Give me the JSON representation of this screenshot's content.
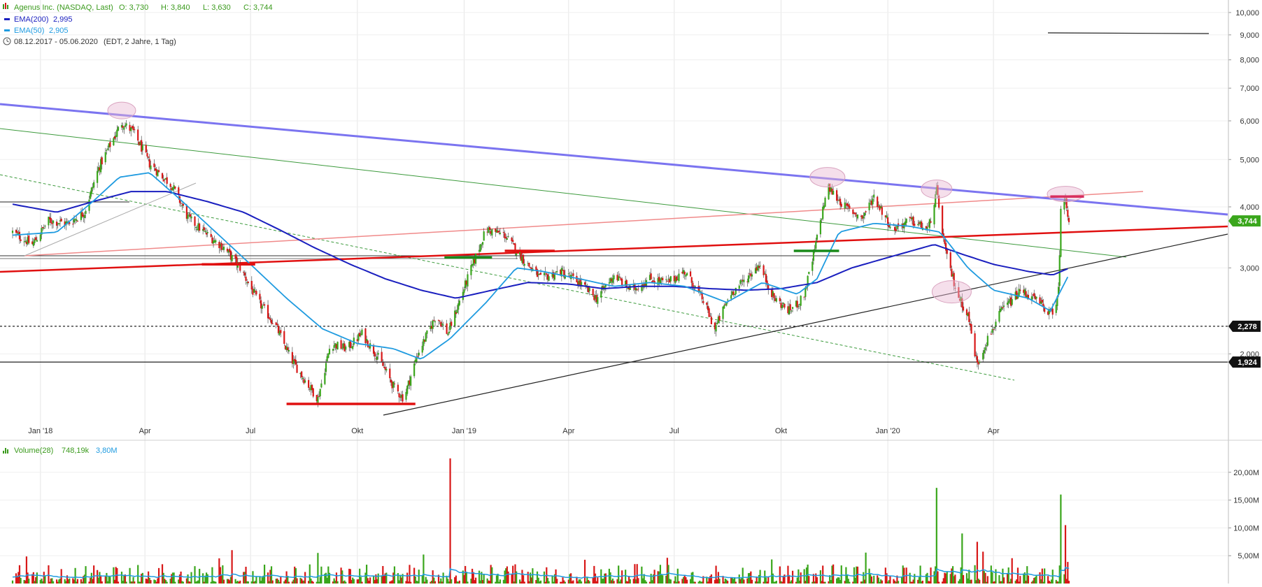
{
  "header": {
    "title": "Agenus Inc. (NASDAQ, Last)",
    "ohlc": {
      "open": "O: 3,730",
      "high": "H: 3,840",
      "low": "L: 3,630",
      "close": "C: 3,744"
    },
    "ema200_label": "EMA(200)",
    "ema200_value": "2,995",
    "ema50_label": "EMA(50)",
    "ema50_value": "2,905",
    "range_text": "08.12.2017 - 05.06.2020",
    "range_note": "(EDT, 2 Jahre, 1 Tag)"
  },
  "colors": {
    "title_green": "#3a9a1c",
    "ema200": "#1a1fbf",
    "ema50": "#1f9be0",
    "bull": "#3aa61c",
    "bear": "#d81818",
    "trend_blue": "#7b74f0",
    "support_red": "#e01010",
    "light_red": "#f08a8a",
    "green_line": "#3c9a3c",
    "circle": "#e8b7d2"
  },
  "chart_data": [
    {
      "type": "candlestick",
      "title": "Agenus Inc. (NASDAQ, Last)",
      "scale": "log",
      "ylim": [
        1.45,
        10.4
      ],
      "y_ticks": [
        "2,000",
        "3,000",
        "4,000",
        "5,000",
        "6,000",
        "7,000",
        "8,000",
        "9,000",
        "10,000"
      ],
      "y_tick_values": [
        2,
        3,
        4,
        5,
        6,
        7,
        8,
        9,
        10
      ],
      "x_range": [
        "2017-12-08",
        "2020-06-05"
      ],
      "x_ticks": [
        "Jan '18",
        "Apr",
        "Jul",
        "Okt",
        "Jan '19",
        "Apr",
        "Jul",
        "Okt",
        "Jan '20",
        "Apr"
      ],
      "x_tick_dates": [
        "2018-01-01",
        "2018-04-01",
        "2018-07-01",
        "2018-10-01",
        "2019-01-01",
        "2019-04-01",
        "2019-07-01",
        "2019-10-01",
        "2020-01-01",
        "2020-04-01"
      ],
      "price_path": [
        [
          "2017-12-08",
          3.55
        ],
        [
          "2017-12-25",
          3.35
        ],
        [
          "2018-01-08",
          3.75
        ],
        [
          "2018-01-25",
          3.7
        ],
        [
          "2018-02-08",
          3.9
        ],
        [
          "2018-02-20",
          4.8
        ],
        [
          "2018-03-01",
          5.3
        ],
        [
          "2018-03-12",
          5.95
        ],
        [
          "2018-03-22",
          5.7
        ],
        [
          "2018-04-05",
          4.9
        ],
        [
          "2018-04-25",
          4.4
        ],
        [
          "2018-05-08",
          3.8
        ],
        [
          "2018-05-22",
          3.55
        ],
        [
          "2018-06-08",
          3.3
        ],
        [
          "2018-06-22",
          3.0
        ],
        [
          "2018-07-08",
          2.55
        ],
        [
          "2018-07-22",
          2.3
        ],
        [
          "2018-08-05",
          1.95
        ],
        [
          "2018-08-18",
          1.75
        ],
        [
          "2018-08-28",
          1.62
        ],
        [
          "2018-09-08",
          2.1
        ],
        [
          "2018-09-22",
          2.05
        ],
        [
          "2018-10-05",
          2.2
        ],
        [
          "2018-10-20",
          1.95
        ],
        [
          "2018-11-02",
          1.7
        ],
        [
          "2018-11-10",
          1.62
        ],
        [
          "2018-11-22",
          2.0
        ],
        [
          "2018-12-08",
          2.4
        ],
        [
          "2018-12-18",
          2.2
        ],
        [
          "2019-01-05",
          2.9
        ],
        [
          "2019-01-20",
          3.6
        ],
        [
          "2019-02-05",
          3.5
        ],
        [
          "2019-02-22",
          3.1
        ],
        [
          "2019-03-08",
          2.85
        ],
        [
          "2019-03-25",
          2.95
        ],
        [
          "2019-04-10",
          2.8
        ],
        [
          "2019-04-25",
          2.6
        ],
        [
          "2019-05-10",
          2.9
        ],
        [
          "2019-05-25",
          2.7
        ],
        [
          "2019-06-10",
          2.85
        ],
        [
          "2019-06-25",
          2.8
        ],
        [
          "2019-07-10",
          2.95
        ],
        [
          "2019-07-25",
          2.6
        ],
        [
          "2019-08-05",
          2.25
        ],
        [
          "2019-08-18",
          2.65
        ],
        [
          "2019-09-01",
          2.85
        ],
        [
          "2019-09-12",
          3.05
        ],
        [
          "2019-09-25",
          2.6
        ],
        [
          "2019-10-08",
          2.45
        ],
        [
          "2019-10-20",
          2.6
        ],
        [
          "2019-10-28",
          3.1
        ],
        [
          "2019-11-05",
          3.85
        ],
        [
          "2019-11-10",
          4.4
        ],
        [
          "2019-11-25",
          4.0
        ],
        [
          "2019-12-10",
          3.8
        ],
        [
          "2019-12-20",
          4.2
        ],
        [
          "2020-01-05",
          3.6
        ],
        [
          "2020-01-20",
          3.75
        ],
        [
          "2020-02-05",
          3.6
        ],
        [
          "2020-02-12",
          4.3
        ],
        [
          "2020-02-20",
          3.2
        ],
        [
          "2020-03-01",
          2.65
        ],
        [
          "2020-03-10",
          2.4
        ],
        [
          "2020-03-18",
          1.9
        ],
        [
          "2020-03-25",
          2.1
        ],
        [
          "2020-04-08",
          2.45
        ],
        [
          "2020-04-25",
          2.7
        ],
        [
          "2020-05-10",
          2.55
        ],
        [
          "2020-05-22",
          2.4
        ],
        [
          "2020-05-27",
          2.7
        ],
        [
          "2020-05-29",
          3.9
        ],
        [
          "2020-06-02",
          4.2
        ],
        [
          "2020-06-05",
          3.744
        ]
      ],
      "series": [
        {
          "name": "EMA(200)",
          "points": [
            [
              "2017-12-08",
              4.05
            ],
            [
              "2018-01-15",
              3.9
            ],
            [
              "2018-02-15",
              4.1
            ],
            [
              "2018-03-20",
              4.3
            ],
            [
              "2018-04-20",
              4.3
            ],
            [
              "2018-05-25",
              4.1
            ],
            [
              "2018-06-25",
              3.9
            ],
            [
              "2018-07-25",
              3.6
            ],
            [
              "2018-08-25",
              3.3
            ],
            [
              "2018-09-25",
              3.05
            ],
            [
              "2018-10-25",
              2.85
            ],
            [
              "2018-11-25",
              2.7
            ],
            [
              "2018-12-25",
              2.6
            ],
            [
              "2019-01-25",
              2.7
            ],
            [
              "2019-02-25",
              2.8
            ],
            [
              "2019-04-01",
              2.78
            ],
            [
              "2019-05-01",
              2.72
            ],
            [
              "2019-06-01",
              2.75
            ],
            [
              "2019-07-01",
              2.75
            ],
            [
              "2019-08-01",
              2.72
            ],
            [
              "2019-09-01",
              2.7
            ],
            [
              "2019-10-01",
              2.72
            ],
            [
              "2019-11-01",
              2.8
            ],
            [
              "2019-12-01",
              3.0
            ],
            [
              "2020-01-01",
              3.15
            ],
            [
              "2020-02-10",
              3.35
            ],
            [
              "2020-03-05",
              3.2
            ],
            [
              "2020-04-01",
              3.05
            ],
            [
              "2020-05-01",
              2.95
            ],
            [
              "2020-05-22",
              2.9
            ],
            [
              "2020-06-05",
              2.995
            ]
          ]
        },
        {
          "name": "EMA(50)",
          "points": [
            [
              "2017-12-08",
              3.5
            ],
            [
              "2018-01-15",
              3.55
            ],
            [
              "2018-02-15",
              4.1
            ],
            [
              "2018-03-10",
              4.6
            ],
            [
              "2018-04-05",
              4.7
            ],
            [
              "2018-05-01",
              4.15
            ],
            [
              "2018-06-01",
              3.55
            ],
            [
              "2018-07-01",
              3.05
            ],
            [
              "2018-08-01",
              2.6
            ],
            [
              "2018-09-01",
              2.25
            ],
            [
              "2018-10-01",
              2.1
            ],
            [
              "2018-11-01",
              2.05
            ],
            [
              "2018-11-25",
              1.95
            ],
            [
              "2018-12-20",
              2.15
            ],
            [
              "2019-01-20",
              2.55
            ],
            [
              "2019-02-15",
              3.0
            ],
            [
              "2019-03-10",
              2.95
            ],
            [
              "2019-04-10",
              2.85
            ],
            [
              "2019-05-10",
              2.75
            ],
            [
              "2019-06-10",
              2.8
            ],
            [
              "2019-07-10",
              2.75
            ],
            [
              "2019-08-15",
              2.55
            ],
            [
              "2019-09-15",
              2.8
            ],
            [
              "2019-10-15",
              2.65
            ],
            [
              "2019-11-01",
              2.85
            ],
            [
              "2019-11-20",
              3.55
            ],
            [
              "2019-12-20",
              3.7
            ],
            [
              "2020-01-20",
              3.65
            ],
            [
              "2020-02-15",
              3.55
            ],
            [
              "2020-03-10",
              3.0
            ],
            [
              "2020-04-01",
              2.7
            ],
            [
              "2020-05-01",
              2.6
            ],
            [
              "2020-05-20",
              2.45
            ],
            [
              "2020-06-05",
              2.905
            ]
          ]
        }
      ],
      "levels": [
        {
          "label": "2,278",
          "value": 2.278,
          "style": "dashed"
        },
        {
          "label": "1,924",
          "value": 1.924,
          "style": "solid"
        }
      ],
      "last_price_label": "3,744",
      "last_price": 3.744,
      "top_right_line": 9.0
    },
    {
      "type": "bar",
      "title": "Volume(28)",
      "legend_value_1": "748,19k",
      "legend_value_2": "3,80M",
      "y_ticks": [
        "5,00M",
        "10,00M",
        "15,00M",
        "20,00M"
      ],
      "y_tick_values": [
        5,
        10,
        15,
        20
      ],
      "ylim": [
        0,
        23.5
      ],
      "unit": "M",
      "spikes": [
        [
          "2018-12-20",
          22.5,
          "bear"
        ],
        [
          "2020-02-12",
          17.2,
          "bull"
        ],
        [
          "2020-05-29",
          16.0,
          "bull"
        ],
        [
          "2020-06-02",
          10.5,
          "bear"
        ],
        [
          "2020-03-05",
          9.0,
          "bull"
        ],
        [
          "2020-03-18",
          7.5,
          "bear"
        ],
        [
          "2018-06-15",
          6.0,
          "bear"
        ],
        [
          "2018-08-28",
          5.5,
          "bull"
        ]
      ]
    }
  ]
}
